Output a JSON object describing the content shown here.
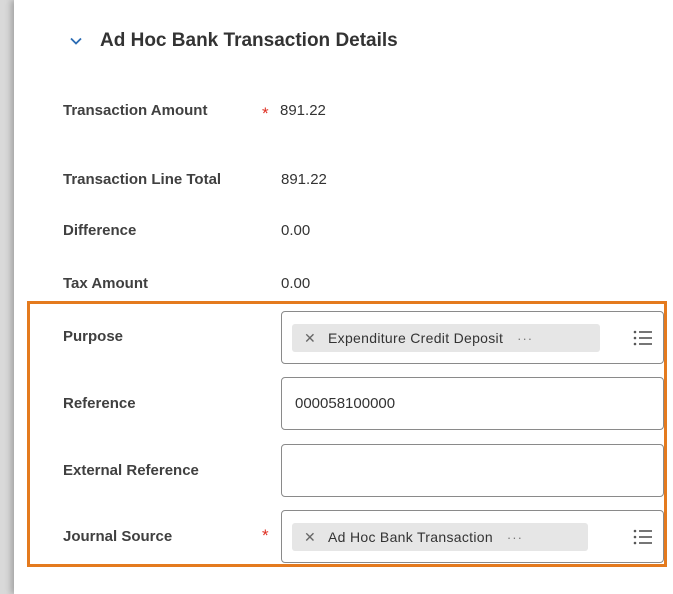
{
  "section": {
    "title": "Ad Hoc Bank Transaction Details"
  },
  "summary": {
    "transaction_amount_label": "Transaction Amount",
    "transaction_amount_value": "891.22",
    "required_mark": "*",
    "line_total_label": "Transaction Line Total",
    "line_total_value": "891.22",
    "difference_label": "Difference",
    "difference_value": "0.00",
    "tax_amount_label": "Tax Amount",
    "tax_amount_value": "0.00"
  },
  "form": {
    "purpose_label": "Purpose",
    "purpose_value": "Expenditure Credit Deposit",
    "reference_label": "Reference",
    "reference_value": "000058100000",
    "external_reference_label": "External Reference",
    "external_reference_value": "",
    "journal_source_label": "Journal Source",
    "journal_source_value": "Ad Hoc Bank Transaction",
    "remove_glyph": "✕",
    "more_glyph": "···"
  },
  "colors": {
    "highlight_border": "#e47a1e",
    "required": "#de2e21"
  }
}
